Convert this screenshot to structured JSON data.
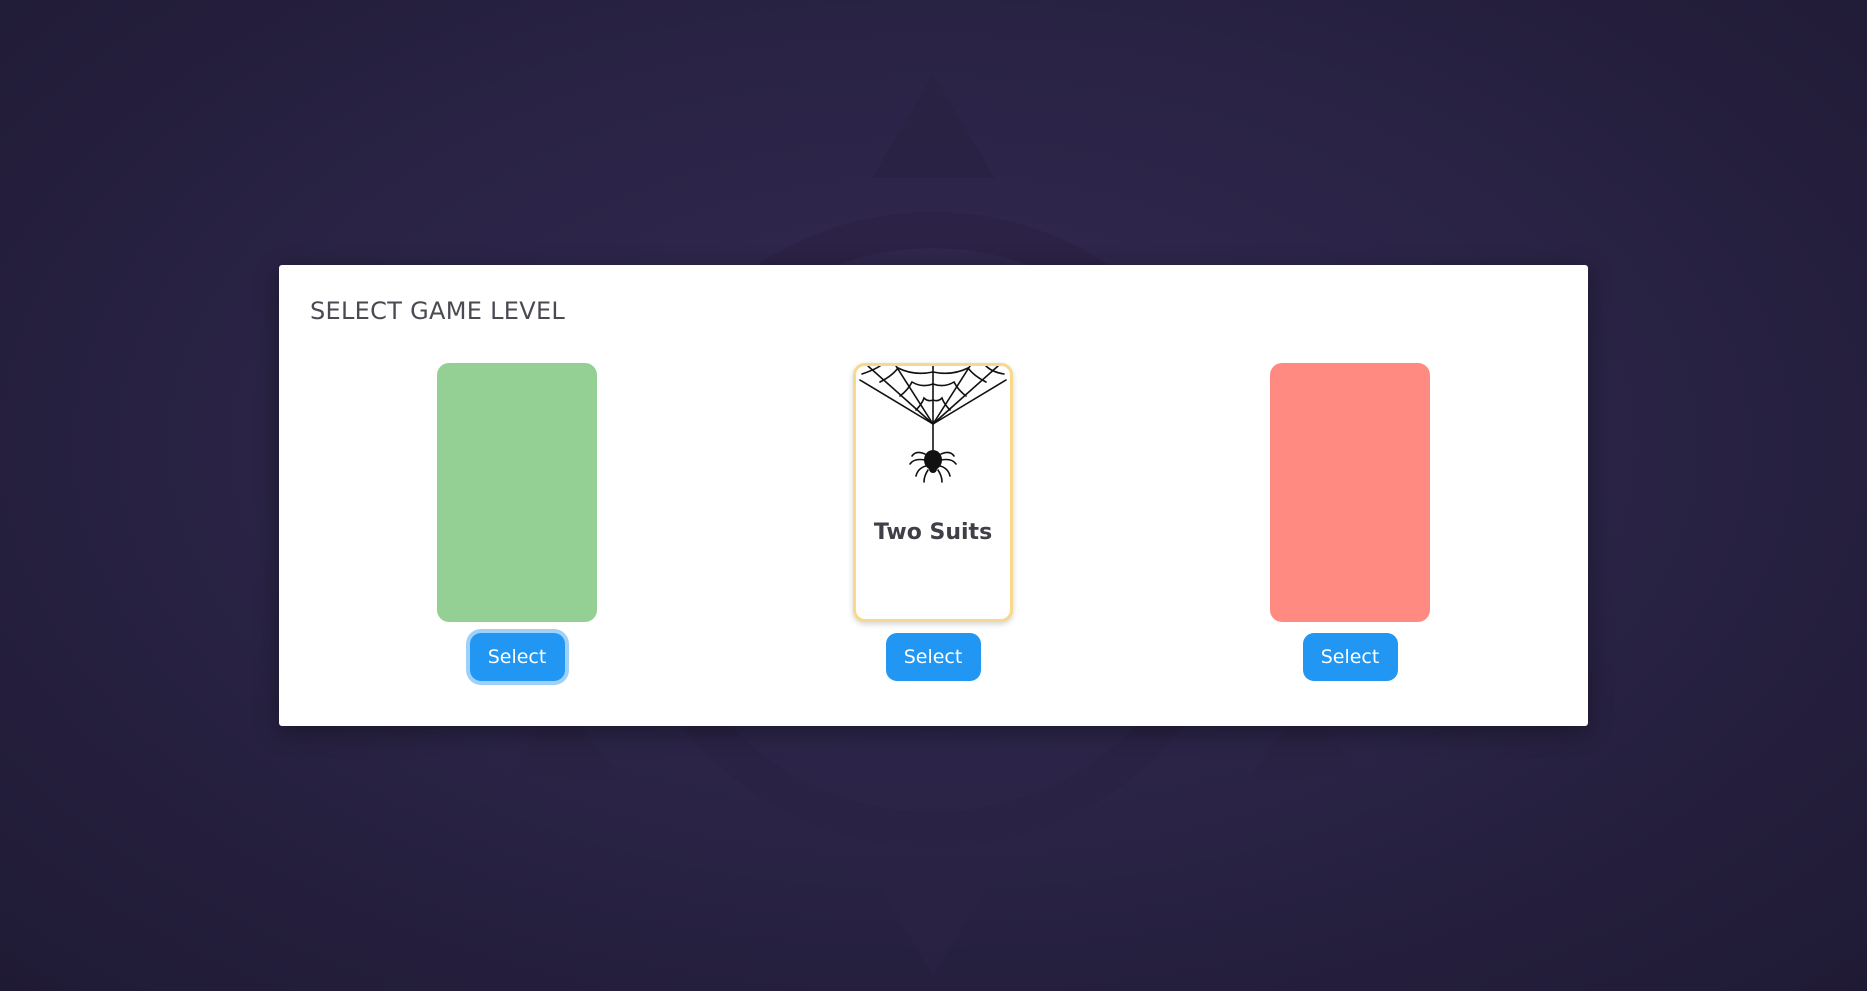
{
  "dialog": {
    "title": "SELECT GAME LEVEL"
  },
  "levels": [
    {
      "name": "",
      "card_color": "#94cf93",
      "button_label": "Select",
      "button_focused": true
    },
    {
      "name": "Two Suits",
      "card_color": "#ffffff",
      "border_color": "#f6d98a",
      "image_icon": "spider-web-icon",
      "button_label": "Select",
      "button_focused": false
    },
    {
      "name": "",
      "card_color": "#ff8a82",
      "button_label": "Select",
      "button_focused": false
    }
  ],
  "colors": {
    "background": "#2b2447",
    "button": "#2196f3",
    "button_focus_ring": "#9fd0f7"
  }
}
